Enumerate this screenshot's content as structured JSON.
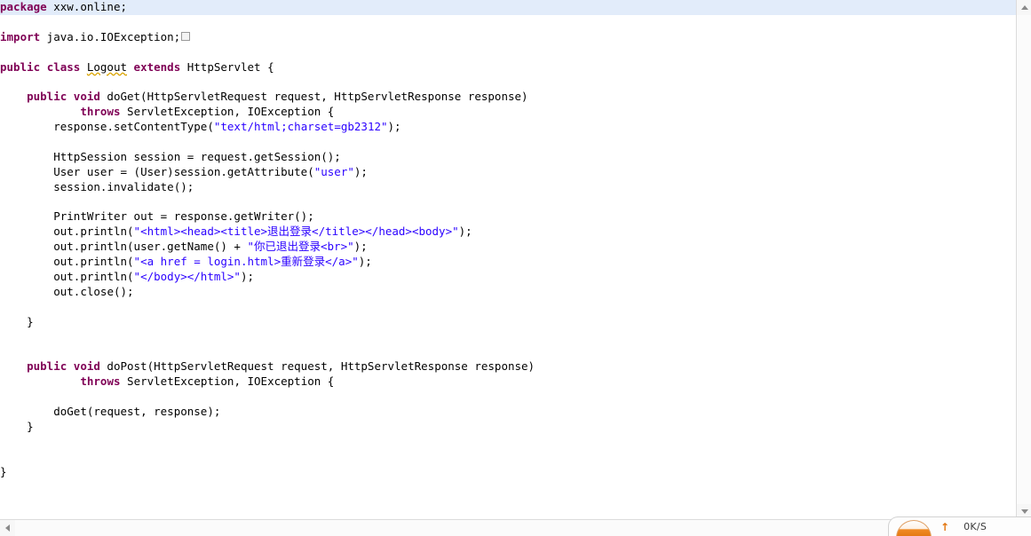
{
  "editor": {
    "current_line_index": 0,
    "colors": {
      "keyword": "#7f0055",
      "string": "#2a00ff",
      "plain": "#000000",
      "current_line_bg": "#e2ecfa",
      "error_underline": "#d9a300",
      "background": "#ffffff"
    },
    "lines": [
      {
        "indent": 0,
        "tokens": [
          {
            "t": "kw",
            "v": "package"
          },
          {
            "t": "plain",
            "v": " xxw.online;"
          }
        ]
      },
      {
        "indent": 0,
        "tokens": []
      },
      {
        "indent": 0,
        "tokens": [
          {
            "t": "kw",
            "v": "import"
          },
          {
            "t": "plain",
            "v": " java.io.IOException;"
          },
          {
            "t": "fold",
            "v": ""
          }
        ]
      },
      {
        "indent": 0,
        "tokens": []
      },
      {
        "indent": 0,
        "tokens": [
          {
            "t": "kw",
            "v": "public"
          },
          {
            "t": "plain",
            "v": " "
          },
          {
            "t": "kw",
            "v": "class"
          },
          {
            "t": "plain",
            "v": " "
          },
          {
            "t": "err",
            "v": "Logout"
          },
          {
            "t": "plain",
            "v": " "
          },
          {
            "t": "kw",
            "v": "extends"
          },
          {
            "t": "plain",
            "v": " HttpServlet {"
          }
        ]
      },
      {
        "indent": 0,
        "tokens": []
      },
      {
        "indent": 4,
        "tokens": [
          {
            "t": "kw",
            "v": "public"
          },
          {
            "t": "plain",
            "v": " "
          },
          {
            "t": "kw",
            "v": "void"
          },
          {
            "t": "plain",
            "v": " doGet(HttpServletRequest request, HttpServletResponse response)"
          }
        ]
      },
      {
        "indent": 12,
        "tokens": [
          {
            "t": "kw",
            "v": "throws"
          },
          {
            "t": "plain",
            "v": " ServletException, IOException {"
          }
        ]
      },
      {
        "indent": 8,
        "tokens": [
          {
            "t": "plain",
            "v": "response.setContentType("
          },
          {
            "t": "str",
            "v": "\"text/html;charset=gb2312\""
          },
          {
            "t": "plain",
            "v": ");"
          }
        ]
      },
      {
        "indent": 0,
        "tokens": []
      },
      {
        "indent": 8,
        "tokens": [
          {
            "t": "plain",
            "v": "HttpSession session = request.getSession();"
          }
        ]
      },
      {
        "indent": 8,
        "tokens": [
          {
            "t": "plain",
            "v": "User user = (User)session.getAttribute("
          },
          {
            "t": "str",
            "v": "\"user\""
          },
          {
            "t": "plain",
            "v": ");"
          }
        ]
      },
      {
        "indent": 8,
        "tokens": [
          {
            "t": "plain",
            "v": "session.invalidate();"
          }
        ]
      },
      {
        "indent": 0,
        "tokens": []
      },
      {
        "indent": 8,
        "tokens": [
          {
            "t": "plain",
            "v": "PrintWriter out = response.getWriter();"
          }
        ]
      },
      {
        "indent": 8,
        "tokens": [
          {
            "t": "plain",
            "v": "out.println("
          },
          {
            "t": "str",
            "v": "\"<html><head><title>退出登录</title></head><body>\""
          },
          {
            "t": "plain",
            "v": ");"
          }
        ]
      },
      {
        "indent": 8,
        "tokens": [
          {
            "t": "plain",
            "v": "out.println(user.getName() + "
          },
          {
            "t": "str",
            "v": "\"你已退出登录<br>\""
          },
          {
            "t": "plain",
            "v": ");"
          }
        ]
      },
      {
        "indent": 8,
        "tokens": [
          {
            "t": "plain",
            "v": "out.println("
          },
          {
            "t": "str",
            "v": "\"<a href = login.html>重新登录</a>\""
          },
          {
            "t": "plain",
            "v": ");"
          }
        ]
      },
      {
        "indent": 8,
        "tokens": [
          {
            "t": "plain",
            "v": "out.println("
          },
          {
            "t": "str",
            "v": "\"</body></html>\""
          },
          {
            "t": "plain",
            "v": ");"
          }
        ]
      },
      {
        "indent": 8,
        "tokens": [
          {
            "t": "plain",
            "v": "out.close();"
          }
        ]
      },
      {
        "indent": 0,
        "tokens": []
      },
      {
        "indent": 4,
        "tokens": [
          {
            "t": "plain",
            "v": "}"
          }
        ]
      },
      {
        "indent": 0,
        "tokens": []
      },
      {
        "indent": 0,
        "tokens": []
      },
      {
        "indent": 4,
        "tokens": [
          {
            "t": "kw",
            "v": "public"
          },
          {
            "t": "plain",
            "v": " "
          },
          {
            "t": "kw",
            "v": "void"
          },
          {
            "t": "plain",
            "v": " doPost(HttpServletRequest request, HttpServletResponse response)"
          }
        ]
      },
      {
        "indent": 12,
        "tokens": [
          {
            "t": "kw",
            "v": "throws"
          },
          {
            "t": "plain",
            "v": " ServletException, IOException {"
          }
        ]
      },
      {
        "indent": 0,
        "tokens": []
      },
      {
        "indent": 8,
        "tokens": [
          {
            "t": "plain",
            "v": "doGet(request, response);"
          }
        ]
      },
      {
        "indent": 4,
        "tokens": [
          {
            "t": "plain",
            "v": "}"
          }
        ]
      },
      {
        "indent": 0,
        "tokens": []
      },
      {
        "indent": 0,
        "tokens": []
      },
      {
        "indent": 0,
        "tokens": [
          {
            "t": "plain",
            "v": "}"
          }
        ]
      }
    ]
  },
  "scrollbars": {
    "vertical": {
      "up_arrow": "▲",
      "down_arrow": "▼"
    },
    "horizontal": {
      "left_arrow": "◄"
    }
  },
  "net_widget": {
    "speed": "0K/S",
    "arrow": "↑",
    "accent_color": "#e2750e"
  }
}
